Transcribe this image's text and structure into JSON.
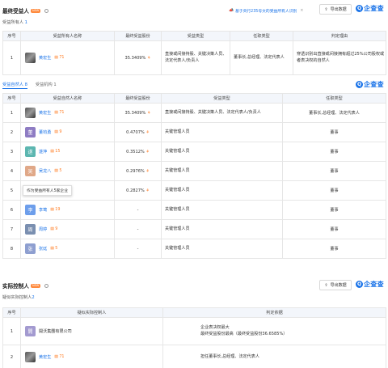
{
  "section1": {
    "title": "最终受益人",
    "badge": "NEW",
    "notice": "基于央行235号文的受益所有人识别",
    "sub_label": "受益所有人",
    "sub_count": "1",
    "export_label": "导出数据",
    "logo_text": "企查查",
    "headers": [
      "序号",
      "受益所有人名称",
      "最终受益股份",
      "受益类型",
      "任职类型",
      "判定理由"
    ],
    "rows": [
      {
        "no": "1",
        "name": "黄宏生",
        "tag": "71",
        "share": "35.3409%",
        "benefit": "直接或间接持股、关键决策人员、法定代表人/负责人",
        "job": "董事长,总经理、法定代表人",
        "reason": "穿透识别出直接或间接拥有超过25%公司股权或者表决权的自然人"
      }
    ]
  },
  "section2": {
    "tab_active": "受益自然人",
    "tab_active_count": "8",
    "tab_inactive": "受益机构",
    "tab_inactive_count": "1",
    "logo_text": "企查查",
    "headers": [
      "序号",
      "受益自然人名称",
      "最终受益股份",
      "受益类型",
      "任职类型"
    ],
    "rows": [
      {
        "no": "1",
        "name": "黄宏生",
        "avatar": "",
        "tag": "71",
        "share": "35.3409%",
        "benefit": "直接或间接持股、关键决策人员、法定代表人/负责人",
        "job": "董事长,总经理、法定代表人"
      },
      {
        "no": "2",
        "name": "董钧勇",
        "avatar": "董",
        "tag": "9",
        "share": "0.4707%",
        "benefit": "关键管理人员",
        "job": "董事"
      },
      {
        "no": "3",
        "name": "遂萍",
        "avatar": "遂",
        "tag": "15",
        "share": "0.3512%",
        "benefit": "关键管理人员",
        "job": "董事"
      },
      {
        "no": "4",
        "name": "吴龙八",
        "avatar": "吴",
        "tag": "5",
        "share": "0.2976%",
        "benefit": "关键管理人员",
        "job": "董事"
      },
      {
        "no": "5",
        "name": "林劲",
        "avatar": "林",
        "tag": "158",
        "share": "0.2827%",
        "benefit": "关键管理人员",
        "job": "董事"
      },
      {
        "no": "6",
        "name": "李莺",
        "avatar": "李",
        "tag": "19",
        "share": "-",
        "benefit": "关键管理人员",
        "job": "董事"
      },
      {
        "no": "7",
        "name": "周婷",
        "avatar": "周",
        "tag": "9",
        "share": "-",
        "benefit": "关键管理人员",
        "job": "董事"
      },
      {
        "no": "8",
        "name": "张廷",
        "avatar": "张",
        "tag": "5",
        "share": "-",
        "benefit": "关键管理人员",
        "job": "董事"
      }
    ],
    "tooltip": "作为受益所有人5家企业"
  },
  "section3": {
    "title": "实际控制人",
    "badge": "NEW",
    "sub_label": "疑似实际控制人",
    "sub_count": "2",
    "export_label": "导出数据",
    "logo_text": "企查查",
    "headers": [
      "序号",
      "疑似实际控制人",
      "判定依据"
    ],
    "rows": [
      {
        "no": "1",
        "name": "開沃集團有限公司",
        "avatar": "開",
        "tag": "",
        "basis1": "企业表决权最大",
        "basis2": "最终受益股份最高（最终受益股份36.6585%）"
      },
      {
        "no": "2",
        "name": "黄宏生",
        "avatar": "",
        "tag": "71",
        "basis1": "担任董事长,总经理、法定代表人",
        "basis2": ""
      }
    ]
  },
  "colors": {
    "accent": "#1a73e8",
    "orange": "#ff7a20",
    "header_bg": "#f3f6fb"
  }
}
